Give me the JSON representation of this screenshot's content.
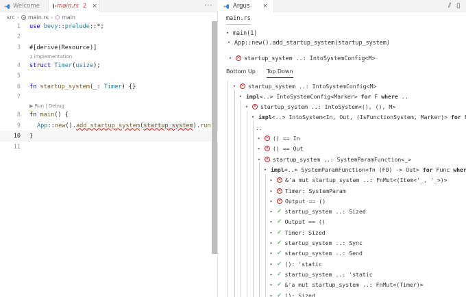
{
  "editor": {
    "tabs": [
      {
        "label": "Welcome",
        "active": false
      },
      {
        "label": "main.rs",
        "active": true,
        "problems": "2"
      }
    ],
    "more_label": "···",
    "breadcrumb": [
      "src",
      "main.rs",
      "main"
    ],
    "code_lens": {
      "implementation": "1 implementation",
      "run_debug": "▶ Run | Debug"
    },
    "line_numbers": [
      "1",
      "2",
      "3",
      "4",
      "5",
      "6",
      "7",
      "8",
      "9",
      "10",
      "11"
    ],
    "code": {
      "l1_a": "use ",
      "l1_b": "bevy",
      "l1_c": "::",
      "l1_d": "prelude",
      "l1_e": "::*;",
      "l3": "#[derive(Resource)]",
      "l4_a": "struct ",
      "l4_b": "Timer",
      "l4_c": "(",
      "l4_d": "usize",
      "l4_e": ");",
      "l6_a": "fn ",
      "l6_b": "startup_system",
      "l6_c": "(_: ",
      "l6_d": "Timer",
      "l6_e": ") {}",
      "l8_a": "fn ",
      "l8_b": "main",
      "l8_c": "() {",
      "l9_a": "App",
      "l9_b": "::",
      "l9_c": "new",
      "l9_d": "().",
      "l9_e": "add_startup_system",
      "l9_f": "(",
      "l9_g": "startup_system",
      "l9_h": ").",
      "l9_i": "run",
      "l9_j": "();",
      "l10": "}"
    }
  },
  "panel": {
    "tab_label": "Argus",
    "tab_close": "×",
    "file": "main.rs",
    "fn_main": "main(1)",
    "call": "App::new().add_startup_system(startup_system)",
    "root_obligation": "startup_system ..: IntoSystemConfig<M>",
    "view_tabs": [
      "Bottom Up",
      "Top Down"
    ],
    "active_view": "Top Down",
    "tree": [
      {
        "depth": 0,
        "chev": "▾",
        "icon": "x",
        "text": "startup_system ..: IntoSystemConfig<M>"
      },
      {
        "depth": 1,
        "chev": "▾",
        "icon": "",
        "bold": "impl",
        "text": "<..> IntoSystemConfig<Marker> ",
        "kw": "for",
        "tail": " F ",
        "kw2": "where",
        "tail2": " .."
      },
      {
        "depth": 2,
        "chev": "▾",
        "icon": "x",
        "text": "startup_system ..: IntoSystem<(), (), M>"
      },
      {
        "depth": 3,
        "chev": "▾",
        "icon": "",
        "bold": "impl",
        "text": "<..> IntoSystem<In, Out, (IsFunctionSystem, Marker)> ",
        "kw": "for",
        "tail": " F ",
        "kw2": "where",
        "tail2": ""
      },
      {
        "depth": 3,
        "chev": "",
        "icon": "",
        "text": "..",
        "cont": true
      },
      {
        "depth": 4,
        "chev": "▸",
        "icon": "x",
        "text": "() == In"
      },
      {
        "depth": 4,
        "chev": "▸",
        "icon": "x",
        "text": "() == Out"
      },
      {
        "depth": 4,
        "chev": "▾",
        "icon": "x",
        "text": "startup_system ..: SystemParamFunction<_>"
      },
      {
        "depth": 5,
        "chev": "▾",
        "icon": "",
        "bold": "impl",
        "text": "<..> SystemParamFunction<fn (F0) -> Out> ",
        "kw": "for",
        "tail": " Func ",
        "kw2": "where",
        "tail2": " .."
      },
      {
        "depth": 6,
        "chev": "▸",
        "icon": "x",
        "text": "&'a mut startup_system ..: FnMut<(Item<'_, '_>)>"
      },
      {
        "depth": 6,
        "chev": "▸",
        "icon": "x",
        "text": "Timer: SystemParam"
      },
      {
        "depth": 6,
        "chev": "▸",
        "icon": "x",
        "text": "Output == ()"
      },
      {
        "depth": 6,
        "chev": "▸",
        "icon": "ok",
        "text": "startup_system ..: Sized"
      },
      {
        "depth": 6,
        "chev": "▸",
        "icon": "ok",
        "text": "Output == ()"
      },
      {
        "depth": 6,
        "chev": "▸",
        "icon": "ok",
        "text": "Timer: Sized"
      },
      {
        "depth": 6,
        "chev": "▸",
        "icon": "ok",
        "text": "startup_system ..: Sync"
      },
      {
        "depth": 6,
        "chev": "▸",
        "icon": "ok",
        "text": "startup_system ..: Send"
      },
      {
        "depth": 6,
        "chev": "▸",
        "icon": "ok",
        "text": "(): 'static"
      },
      {
        "depth": 6,
        "chev": "▸",
        "icon": "ok",
        "text": "startup_system ..: 'static"
      },
      {
        "depth": 6,
        "chev": "▸",
        "icon": "ok",
        "text": "&'a mut startup_system ..: FnMut<(Timer)>"
      },
      {
        "depth": 6,
        "chev": "▸",
        "icon": "ok",
        "text": "(): Sized"
      }
    ]
  },
  "colors": {
    "keyword": "#0000ff",
    "type": "#267f99",
    "function": "#795e26",
    "error": "#c62828",
    "success": "#388e3c"
  }
}
